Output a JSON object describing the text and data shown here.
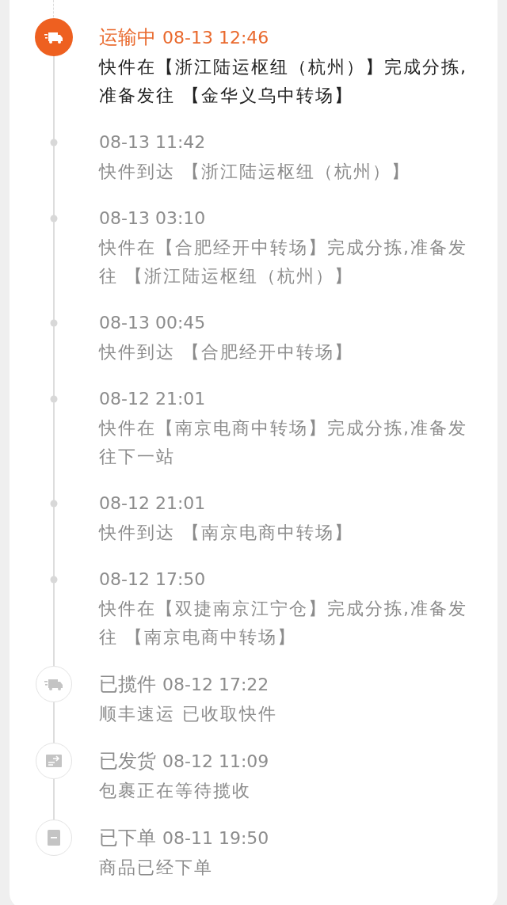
{
  "timeline": [
    {
      "kind": "current",
      "status": "运输中",
      "time": "08-13 12:46",
      "text": "快件在【浙江陆运枢纽（杭州）】完成分拣,准备发往 【金华义乌中转场】"
    },
    {
      "kind": "dot",
      "time": "08-13 11:42",
      "text": "快件到达 【浙江陆运枢纽（杭州）】"
    },
    {
      "kind": "dot",
      "time": "08-13 03:10",
      "text": "快件在【合肥经开中转场】完成分拣,准备发往 【浙江陆运枢纽（杭州）】"
    },
    {
      "kind": "dot",
      "time": "08-13 00:45",
      "text": "快件到达 【合肥经开中转场】"
    },
    {
      "kind": "dot",
      "time": "08-12 21:01",
      "text": "快件在【南京电商中转场】完成分拣,准备发往下一站"
    },
    {
      "kind": "dot",
      "time": "08-12 21:01",
      "text": "快件到达 【南京电商中转场】"
    },
    {
      "kind": "dot",
      "time": "08-12 17:50",
      "text": "快件在【双捷南京江宁仓】完成分拣,准备发往 【南京电商中转场】"
    },
    {
      "kind": "collected",
      "status": "已揽件",
      "time": "08-12 17:22",
      "text": "顺丰速运 已收取快件"
    },
    {
      "kind": "shipped",
      "status": "已发货",
      "time": "08-12 11:09",
      "text": "包裹正在等待揽收"
    },
    {
      "kind": "ordered",
      "status": "已下单",
      "time": "08-11 19:50",
      "text": "商品已经下单"
    }
  ]
}
